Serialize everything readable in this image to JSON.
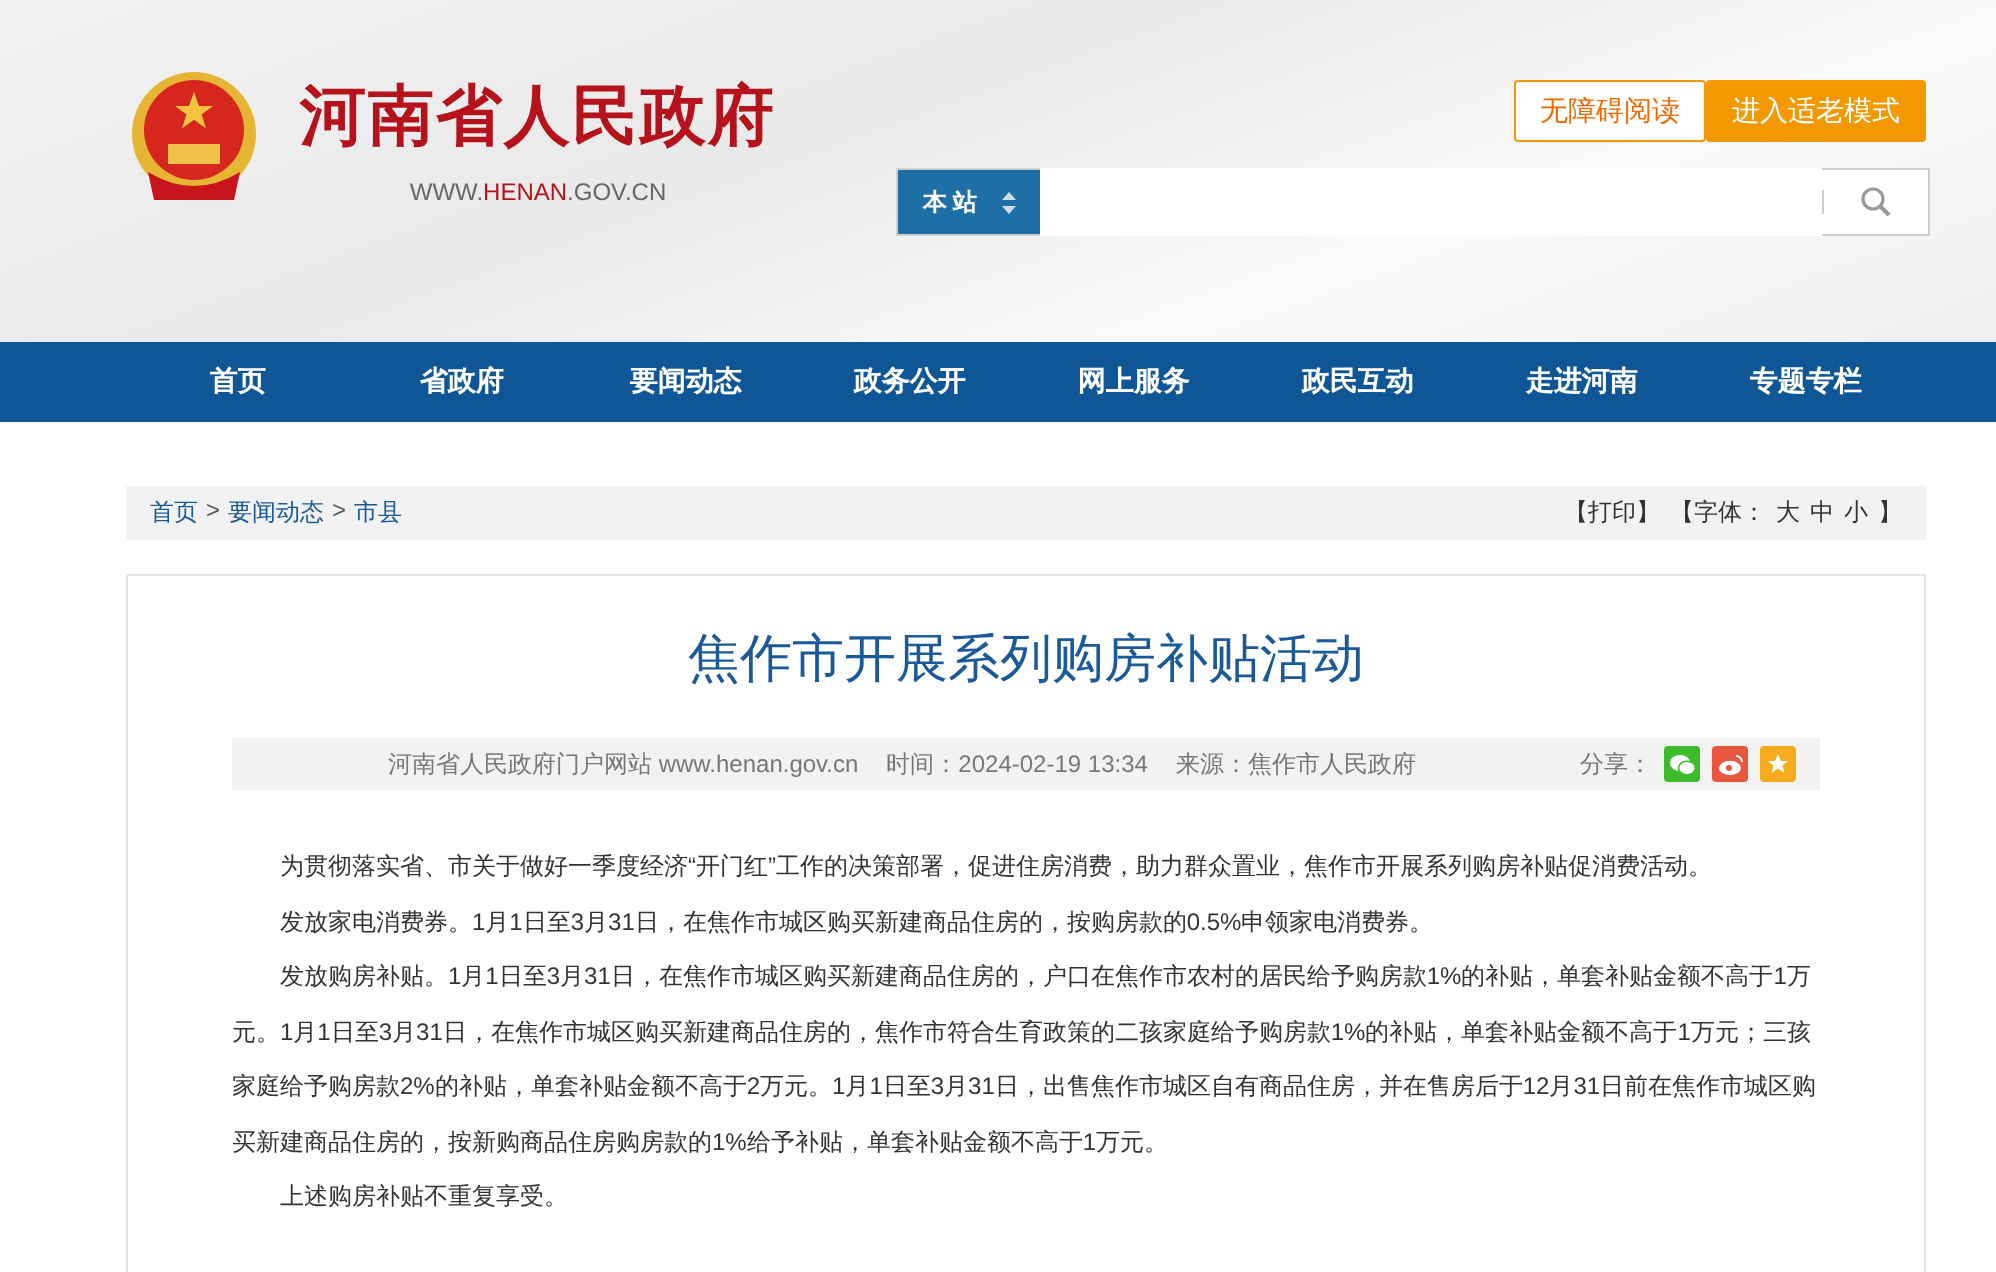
{
  "header": {
    "site_name": "河南省人民政府",
    "url_parts": [
      {
        "text": "WWW.",
        "highlight": false
      },
      {
        "text": "HENAN",
        "highlight": true
      },
      {
        "text": ".GOV.CN",
        "highlight": false
      }
    ],
    "buttons": [
      {
        "label": "无障碍阅读",
        "kind": "outline"
      },
      {
        "label": "进入适老模式",
        "kind": "filled"
      }
    ],
    "search": {
      "scope": "本 站"
    }
  },
  "nav": [
    {
      "label": "首页"
    },
    {
      "label": "省政府"
    },
    {
      "label": "要闻动态"
    },
    {
      "label": "政务公开"
    },
    {
      "label": "网上服务"
    },
    {
      "label": "政民互动"
    },
    {
      "label": "走进河南"
    },
    {
      "label": "专题专栏"
    }
  ],
  "breadcrumb": [
    "首页",
    "要闻动态",
    "市县"
  ],
  "breadcrumb_separator": ">",
  "tools": {
    "print": "【打印】",
    "font_label": "【字体：",
    "sizes": [
      "大",
      "中",
      "小"
    ],
    "close": "】"
  },
  "article": {
    "title": "焦作市开展系列购房补贴活动",
    "meta": [
      "河南省人民政府门户网站 www.henan.gov.cn",
      "时间：2024-02-19 13:34",
      "来源：焦作市人民政府"
    ],
    "share_label": "分享：",
    "share": [
      {
        "kind": "wechat",
        "color": "#3dbb2d"
      },
      {
        "kind": "weibo",
        "color": "#e8573e"
      },
      {
        "kind": "favorite",
        "color": "#f6ab1c"
      }
    ],
    "paragraphs": [
      "为贯彻落实省、市关于做好一季度经济“开门红”工作的决策部署，促进住房消费，助力群众置业，焦作市开展系列购房补贴促消费活动。",
      "发放家电消费券。1月1日至3月31日，在焦作市城区购买新建商品住房的，按购房款的0.5%申领家电消费券。",
      "发放购房补贴。1月1日至3月31日，在焦作市城区购买新建商品住房的，户口在焦作市农村的居民给予购房款1%的补贴，单套补贴金额不高于1万元。1月1日至3月31日，在焦作市城区购买新建商品住房的，焦作市符合生育政策的二孩家庭给予购房款1%的补贴，单套补贴金额不高于1万元；三孩家庭给予购房款2%的补贴，单套补贴金额不高于2万元。1月1日至3月31日，出售焦作市城区自有商品住房，并在售房后于12月31日前在焦作市城区购买新建商品住房的，按新购商品住房购房款的1%给予补贴，单套补贴金额不高于1万元。",
      "上述购房补贴不重复享受。"
    ]
  }
}
